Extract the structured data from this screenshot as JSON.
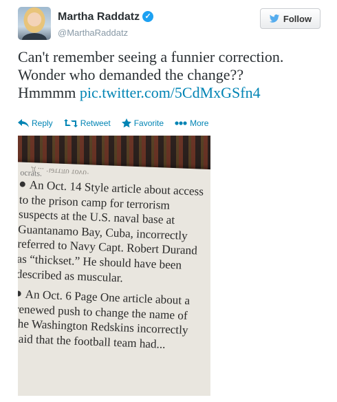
{
  "user": {
    "name": "Martha Raddatz",
    "handle": "@MarthaRaddatz"
  },
  "follow_label": "Follow",
  "tweet": {
    "line1": "Can't remember seeing a funnier correction.",
    "line2": "Wonder who demanded the change??",
    "line3_prefix": "Hmmmm ",
    "link": "pic.twitter.com/5CdMxGSfn4"
  },
  "actions": {
    "reply": "Reply",
    "retweet": "Retweet",
    "favorite": "Favorite",
    "more": "More"
  },
  "photo": {
    "mirror_text": "д ... ·ιəττπυ τονυ·",
    "ocrats": "ocrats.",
    "paragraph1": "An Oct. 14 Style article about access to the prison camp for terrorism suspects at the U.S. naval base at Guantanamo Bay, Cuba, incorrectly referred to Navy Capt. Robert Durand as “thickset.” He should have been described as muscular.",
    "paragraph2": "An Oct. 6 Page One article about a renewed push to change the name of the Washington Redskins incorrectly said that the football team had..."
  },
  "colors": {
    "link": "#0084b4",
    "verified": "#1da1f2",
    "bird": "#55acee"
  }
}
